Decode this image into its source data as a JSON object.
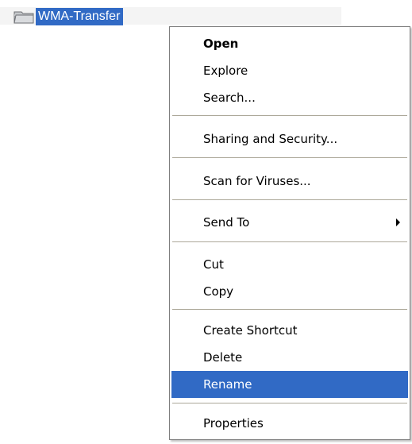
{
  "tree": {
    "selected_item": "WMA-Transfer"
  },
  "context_menu": {
    "items": [
      {
        "label": "Open"
      },
      {
        "label": "Explore"
      },
      {
        "label": "Search..."
      },
      {
        "label": "Sharing and Security..."
      },
      {
        "label": "Scan for Viruses..."
      },
      {
        "label": "Send To"
      },
      {
        "label": "Cut"
      },
      {
        "label": "Copy"
      },
      {
        "label": "Create Shortcut"
      },
      {
        "label": "Delete"
      },
      {
        "label": "Rename"
      },
      {
        "label": "Properties"
      }
    ],
    "selected_label": "Rename",
    "submenu_arrow_icon": "triangle-right-icon"
  },
  "colors": {
    "selection_blue": "#316ac5",
    "selection_text": "#ffffff",
    "separator": "#aca899",
    "menu_border": "#7f7f7f",
    "folder_body": "#c5c8cb",
    "folder_outline": "#6e7175"
  }
}
